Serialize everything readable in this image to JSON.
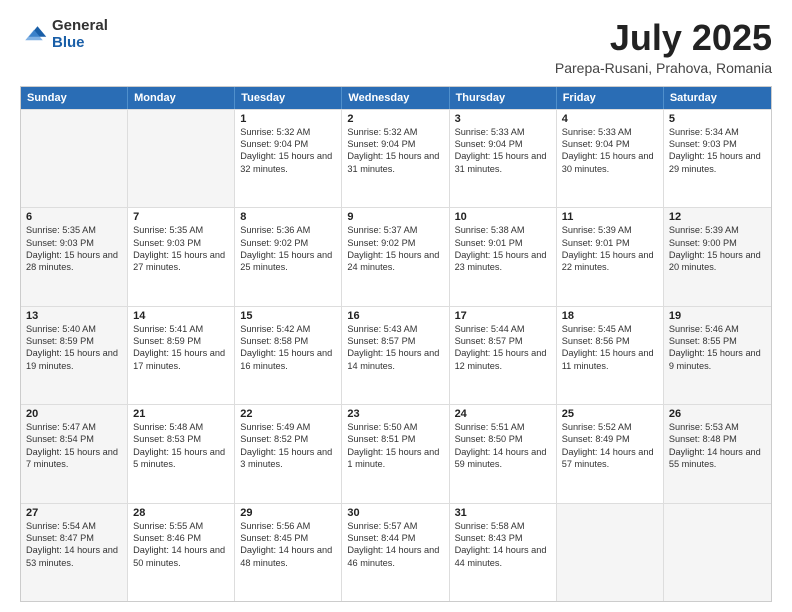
{
  "header": {
    "logo_general": "General",
    "logo_blue": "Blue",
    "month_year": "July 2025",
    "location": "Parepa-Rusani, Prahova, Romania"
  },
  "weekdays": [
    "Sunday",
    "Monday",
    "Tuesday",
    "Wednesday",
    "Thursday",
    "Friday",
    "Saturday"
  ],
  "rows": [
    [
      {
        "day": "",
        "sunrise": "",
        "sunset": "",
        "daylight": "",
        "shaded": true
      },
      {
        "day": "",
        "sunrise": "",
        "sunset": "",
        "daylight": "",
        "shaded": true
      },
      {
        "day": "1",
        "sunrise": "Sunrise: 5:32 AM",
        "sunset": "Sunset: 9:04 PM",
        "daylight": "Daylight: 15 hours and 32 minutes.",
        "shaded": false
      },
      {
        "day": "2",
        "sunrise": "Sunrise: 5:32 AM",
        "sunset": "Sunset: 9:04 PM",
        "daylight": "Daylight: 15 hours and 31 minutes.",
        "shaded": false
      },
      {
        "day": "3",
        "sunrise": "Sunrise: 5:33 AM",
        "sunset": "Sunset: 9:04 PM",
        "daylight": "Daylight: 15 hours and 31 minutes.",
        "shaded": false
      },
      {
        "day": "4",
        "sunrise": "Sunrise: 5:33 AM",
        "sunset": "Sunset: 9:04 PM",
        "daylight": "Daylight: 15 hours and 30 minutes.",
        "shaded": false
      },
      {
        "day": "5",
        "sunrise": "Sunrise: 5:34 AM",
        "sunset": "Sunset: 9:03 PM",
        "daylight": "Daylight: 15 hours and 29 minutes.",
        "shaded": false
      }
    ],
    [
      {
        "day": "6",
        "sunrise": "Sunrise: 5:35 AM",
        "sunset": "Sunset: 9:03 PM",
        "daylight": "Daylight: 15 hours and 28 minutes.",
        "shaded": true
      },
      {
        "day": "7",
        "sunrise": "Sunrise: 5:35 AM",
        "sunset": "Sunset: 9:03 PM",
        "daylight": "Daylight: 15 hours and 27 minutes.",
        "shaded": false
      },
      {
        "day": "8",
        "sunrise": "Sunrise: 5:36 AM",
        "sunset": "Sunset: 9:02 PM",
        "daylight": "Daylight: 15 hours and 25 minutes.",
        "shaded": false
      },
      {
        "day": "9",
        "sunrise": "Sunrise: 5:37 AM",
        "sunset": "Sunset: 9:02 PM",
        "daylight": "Daylight: 15 hours and 24 minutes.",
        "shaded": false
      },
      {
        "day": "10",
        "sunrise": "Sunrise: 5:38 AM",
        "sunset": "Sunset: 9:01 PM",
        "daylight": "Daylight: 15 hours and 23 minutes.",
        "shaded": false
      },
      {
        "day": "11",
        "sunrise": "Sunrise: 5:39 AM",
        "sunset": "Sunset: 9:01 PM",
        "daylight": "Daylight: 15 hours and 22 minutes.",
        "shaded": false
      },
      {
        "day": "12",
        "sunrise": "Sunrise: 5:39 AM",
        "sunset": "Sunset: 9:00 PM",
        "daylight": "Daylight: 15 hours and 20 minutes.",
        "shaded": true
      }
    ],
    [
      {
        "day": "13",
        "sunrise": "Sunrise: 5:40 AM",
        "sunset": "Sunset: 8:59 PM",
        "daylight": "Daylight: 15 hours and 19 minutes.",
        "shaded": true
      },
      {
        "day": "14",
        "sunrise": "Sunrise: 5:41 AM",
        "sunset": "Sunset: 8:59 PM",
        "daylight": "Daylight: 15 hours and 17 minutes.",
        "shaded": false
      },
      {
        "day": "15",
        "sunrise": "Sunrise: 5:42 AM",
        "sunset": "Sunset: 8:58 PM",
        "daylight": "Daylight: 15 hours and 16 minutes.",
        "shaded": false
      },
      {
        "day": "16",
        "sunrise": "Sunrise: 5:43 AM",
        "sunset": "Sunset: 8:57 PM",
        "daylight": "Daylight: 15 hours and 14 minutes.",
        "shaded": false
      },
      {
        "day": "17",
        "sunrise": "Sunrise: 5:44 AM",
        "sunset": "Sunset: 8:57 PM",
        "daylight": "Daylight: 15 hours and 12 minutes.",
        "shaded": false
      },
      {
        "day": "18",
        "sunrise": "Sunrise: 5:45 AM",
        "sunset": "Sunset: 8:56 PM",
        "daylight": "Daylight: 15 hours and 11 minutes.",
        "shaded": false
      },
      {
        "day": "19",
        "sunrise": "Sunrise: 5:46 AM",
        "sunset": "Sunset: 8:55 PM",
        "daylight": "Daylight: 15 hours and 9 minutes.",
        "shaded": true
      }
    ],
    [
      {
        "day": "20",
        "sunrise": "Sunrise: 5:47 AM",
        "sunset": "Sunset: 8:54 PM",
        "daylight": "Daylight: 15 hours and 7 minutes.",
        "shaded": true
      },
      {
        "day": "21",
        "sunrise": "Sunrise: 5:48 AM",
        "sunset": "Sunset: 8:53 PM",
        "daylight": "Daylight: 15 hours and 5 minutes.",
        "shaded": false
      },
      {
        "day": "22",
        "sunrise": "Sunrise: 5:49 AM",
        "sunset": "Sunset: 8:52 PM",
        "daylight": "Daylight: 15 hours and 3 minutes.",
        "shaded": false
      },
      {
        "day": "23",
        "sunrise": "Sunrise: 5:50 AM",
        "sunset": "Sunset: 8:51 PM",
        "daylight": "Daylight: 15 hours and 1 minute.",
        "shaded": false
      },
      {
        "day": "24",
        "sunrise": "Sunrise: 5:51 AM",
        "sunset": "Sunset: 8:50 PM",
        "daylight": "Daylight: 14 hours and 59 minutes.",
        "shaded": false
      },
      {
        "day": "25",
        "sunrise": "Sunrise: 5:52 AM",
        "sunset": "Sunset: 8:49 PM",
        "daylight": "Daylight: 14 hours and 57 minutes.",
        "shaded": false
      },
      {
        "day": "26",
        "sunrise": "Sunrise: 5:53 AM",
        "sunset": "Sunset: 8:48 PM",
        "daylight": "Daylight: 14 hours and 55 minutes.",
        "shaded": true
      }
    ],
    [
      {
        "day": "27",
        "sunrise": "Sunrise: 5:54 AM",
        "sunset": "Sunset: 8:47 PM",
        "daylight": "Daylight: 14 hours and 53 minutes.",
        "shaded": true
      },
      {
        "day": "28",
        "sunrise": "Sunrise: 5:55 AM",
        "sunset": "Sunset: 8:46 PM",
        "daylight": "Daylight: 14 hours and 50 minutes.",
        "shaded": false
      },
      {
        "day": "29",
        "sunrise": "Sunrise: 5:56 AM",
        "sunset": "Sunset: 8:45 PM",
        "daylight": "Daylight: 14 hours and 48 minutes.",
        "shaded": false
      },
      {
        "day": "30",
        "sunrise": "Sunrise: 5:57 AM",
        "sunset": "Sunset: 8:44 PM",
        "daylight": "Daylight: 14 hours and 46 minutes.",
        "shaded": false
      },
      {
        "day": "31",
        "sunrise": "Sunrise: 5:58 AM",
        "sunset": "Sunset: 8:43 PM",
        "daylight": "Daylight: 14 hours and 44 minutes.",
        "shaded": false
      },
      {
        "day": "",
        "sunrise": "",
        "sunset": "",
        "daylight": "",
        "shaded": true
      },
      {
        "day": "",
        "sunrise": "",
        "sunset": "",
        "daylight": "",
        "shaded": true
      }
    ]
  ]
}
